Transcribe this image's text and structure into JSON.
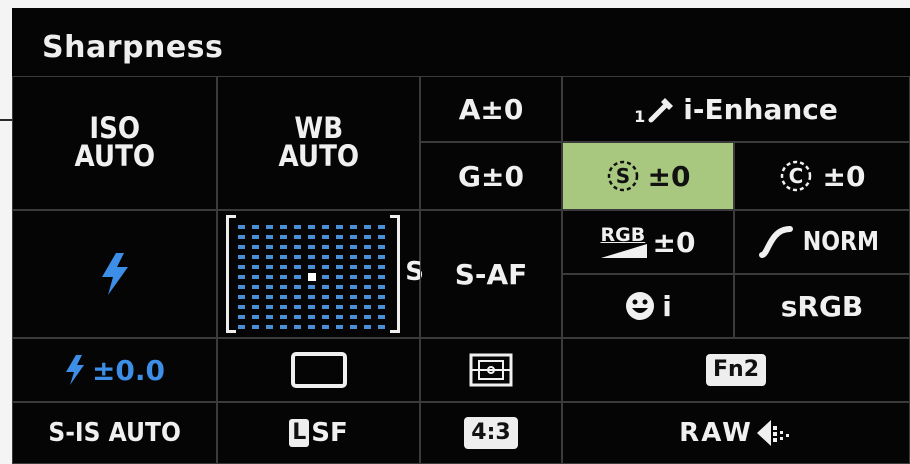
{
  "title": "Sharpness",
  "iso": {
    "line1": "ISO",
    "line2": "AUTO"
  },
  "wb": {
    "line1": "WB",
    "line2": "AUTO"
  },
  "wb_adjust": {
    "a": "A±0",
    "g": "G±0"
  },
  "picture_mode": {
    "number": "1",
    "label": "i-Enhance"
  },
  "sharpness": {
    "value": "±0"
  },
  "contrast": {
    "value": "±0"
  },
  "saturation": {
    "label": "RGB",
    "value": "±0"
  },
  "gradation": {
    "label": "NORM"
  },
  "face_priority": {
    "label": "i"
  },
  "color_space": {
    "label": "sRGB"
  },
  "af_target": {
    "suffix": "S"
  },
  "af_mode": {
    "label": "S-AF"
  },
  "flash_comp": {
    "value": "±0.0"
  },
  "fn2": {
    "label": "Fn2"
  },
  "stabilizer": {
    "label": "S-IS AUTO"
  },
  "image_quality": {
    "badge": "L",
    "label": "SF"
  },
  "aspect": {
    "label": "4:3"
  },
  "raw": {
    "label": "RAW"
  },
  "colors": {
    "accent_blue": "#3d8ee6",
    "selected_bg": "#a9c87f",
    "background": "#050505"
  }
}
